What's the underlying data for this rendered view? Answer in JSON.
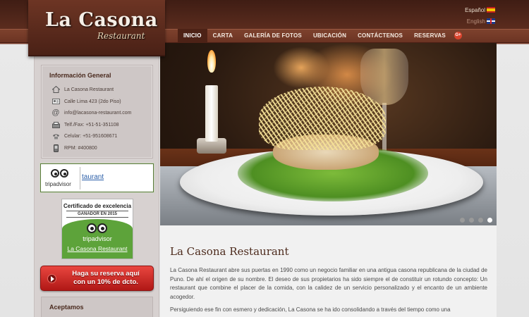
{
  "brand": {
    "name": "La Casona",
    "sub": "Restaurant"
  },
  "languages": {
    "es": "Español",
    "en": "English"
  },
  "nav": {
    "items": [
      "INICIO",
      "CARTA",
      "GALERÍA DE FOTOS",
      "UBICACIÓN",
      "CONTÁCTENOS",
      "RESERVAS"
    ],
    "active": "INICIO",
    "gplus": "G+"
  },
  "info": {
    "title": "Información General",
    "rows": [
      {
        "icon": "home-icon",
        "text": "La Casona Restaurant"
      },
      {
        "icon": "address-card-icon",
        "text": "Calle Lima 423 (2do Piso)"
      },
      {
        "icon": "at-icon",
        "text": "info@lacasona-restaurant.com"
      },
      {
        "icon": "fax-icon",
        "text": "Telf./Fax: +51-51-351108"
      },
      {
        "icon": "phone-icon",
        "text": "Celular: +51-951608671"
      },
      {
        "icon": "mobile-icon",
        "text": "RPM: #400800"
      }
    ]
  },
  "tripadvisor": {
    "brand": "tripadvisor",
    "link_text": "taurant"
  },
  "certificate": {
    "title": "Certificado de excelencia",
    "subtitle": "GANADOR EN 2015",
    "brand": "tripadvisor",
    "link_text": "La Casona Restaurant"
  },
  "reserve": {
    "line1": "Haga su reserva aquí",
    "line2": "con un 10% de dcto."
  },
  "accept": {
    "title": "Aceptamos"
  },
  "slider": {
    "dot_count": 4,
    "active_index": 3
  },
  "content": {
    "title": "La Casona Restaurant",
    "p1": "La Casona Restaurant abre sus puertas en 1990 como un negocio familiar en una antigua casona republicana de la ciudad de Puno. De ahí el origen de su nombre. El deseo de sus propietarios ha sido siempre el de constituir un rotundo concepto: Un restaurant que combine el placer de la comida, con la calidez de un servicio personalizado y el encanto de un ambiente acogedor.",
    "p2": "Persiguiendo ese fin con esmero y dedicación, La Casona se ha ido consolidando a través del tiempo como una"
  },
  "colors": {
    "header_brown": "#5a2c1e",
    "nav_active": "#4d2216",
    "reserve_red": "#d0302a",
    "trip_green": "#5da33a"
  }
}
